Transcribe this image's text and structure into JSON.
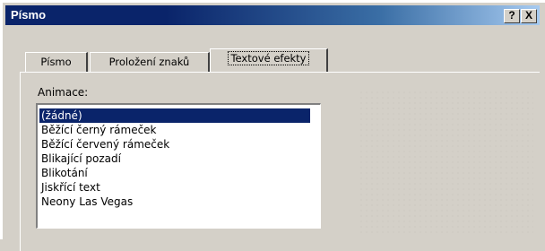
{
  "window": {
    "title": "Písmo"
  },
  "titlebar_buttons": {
    "help": "?",
    "close": "X"
  },
  "tabs": [
    {
      "label": "Písmo",
      "active": false
    },
    {
      "label": "Proložení znaků",
      "active": false
    },
    {
      "label": "Textové efekty",
      "active": true
    }
  ],
  "animation": {
    "label": "Animace:",
    "items": [
      {
        "label": "(žádné)",
        "selected": true
      },
      {
        "label": "Běžící černý rámeček",
        "selected": false
      },
      {
        "label": "Běžící červený rámeček",
        "selected": false
      },
      {
        "label": "Blikající pozadí",
        "selected": false
      },
      {
        "label": "Blikotání",
        "selected": false
      },
      {
        "label": "Jiskřící text",
        "selected": false
      },
      {
        "label": "Neony Las Vegas",
        "selected": false
      }
    ]
  },
  "colors": {
    "titlebar": "#0a246a",
    "selection": "#0a246a",
    "face": "#d4d0c8"
  }
}
